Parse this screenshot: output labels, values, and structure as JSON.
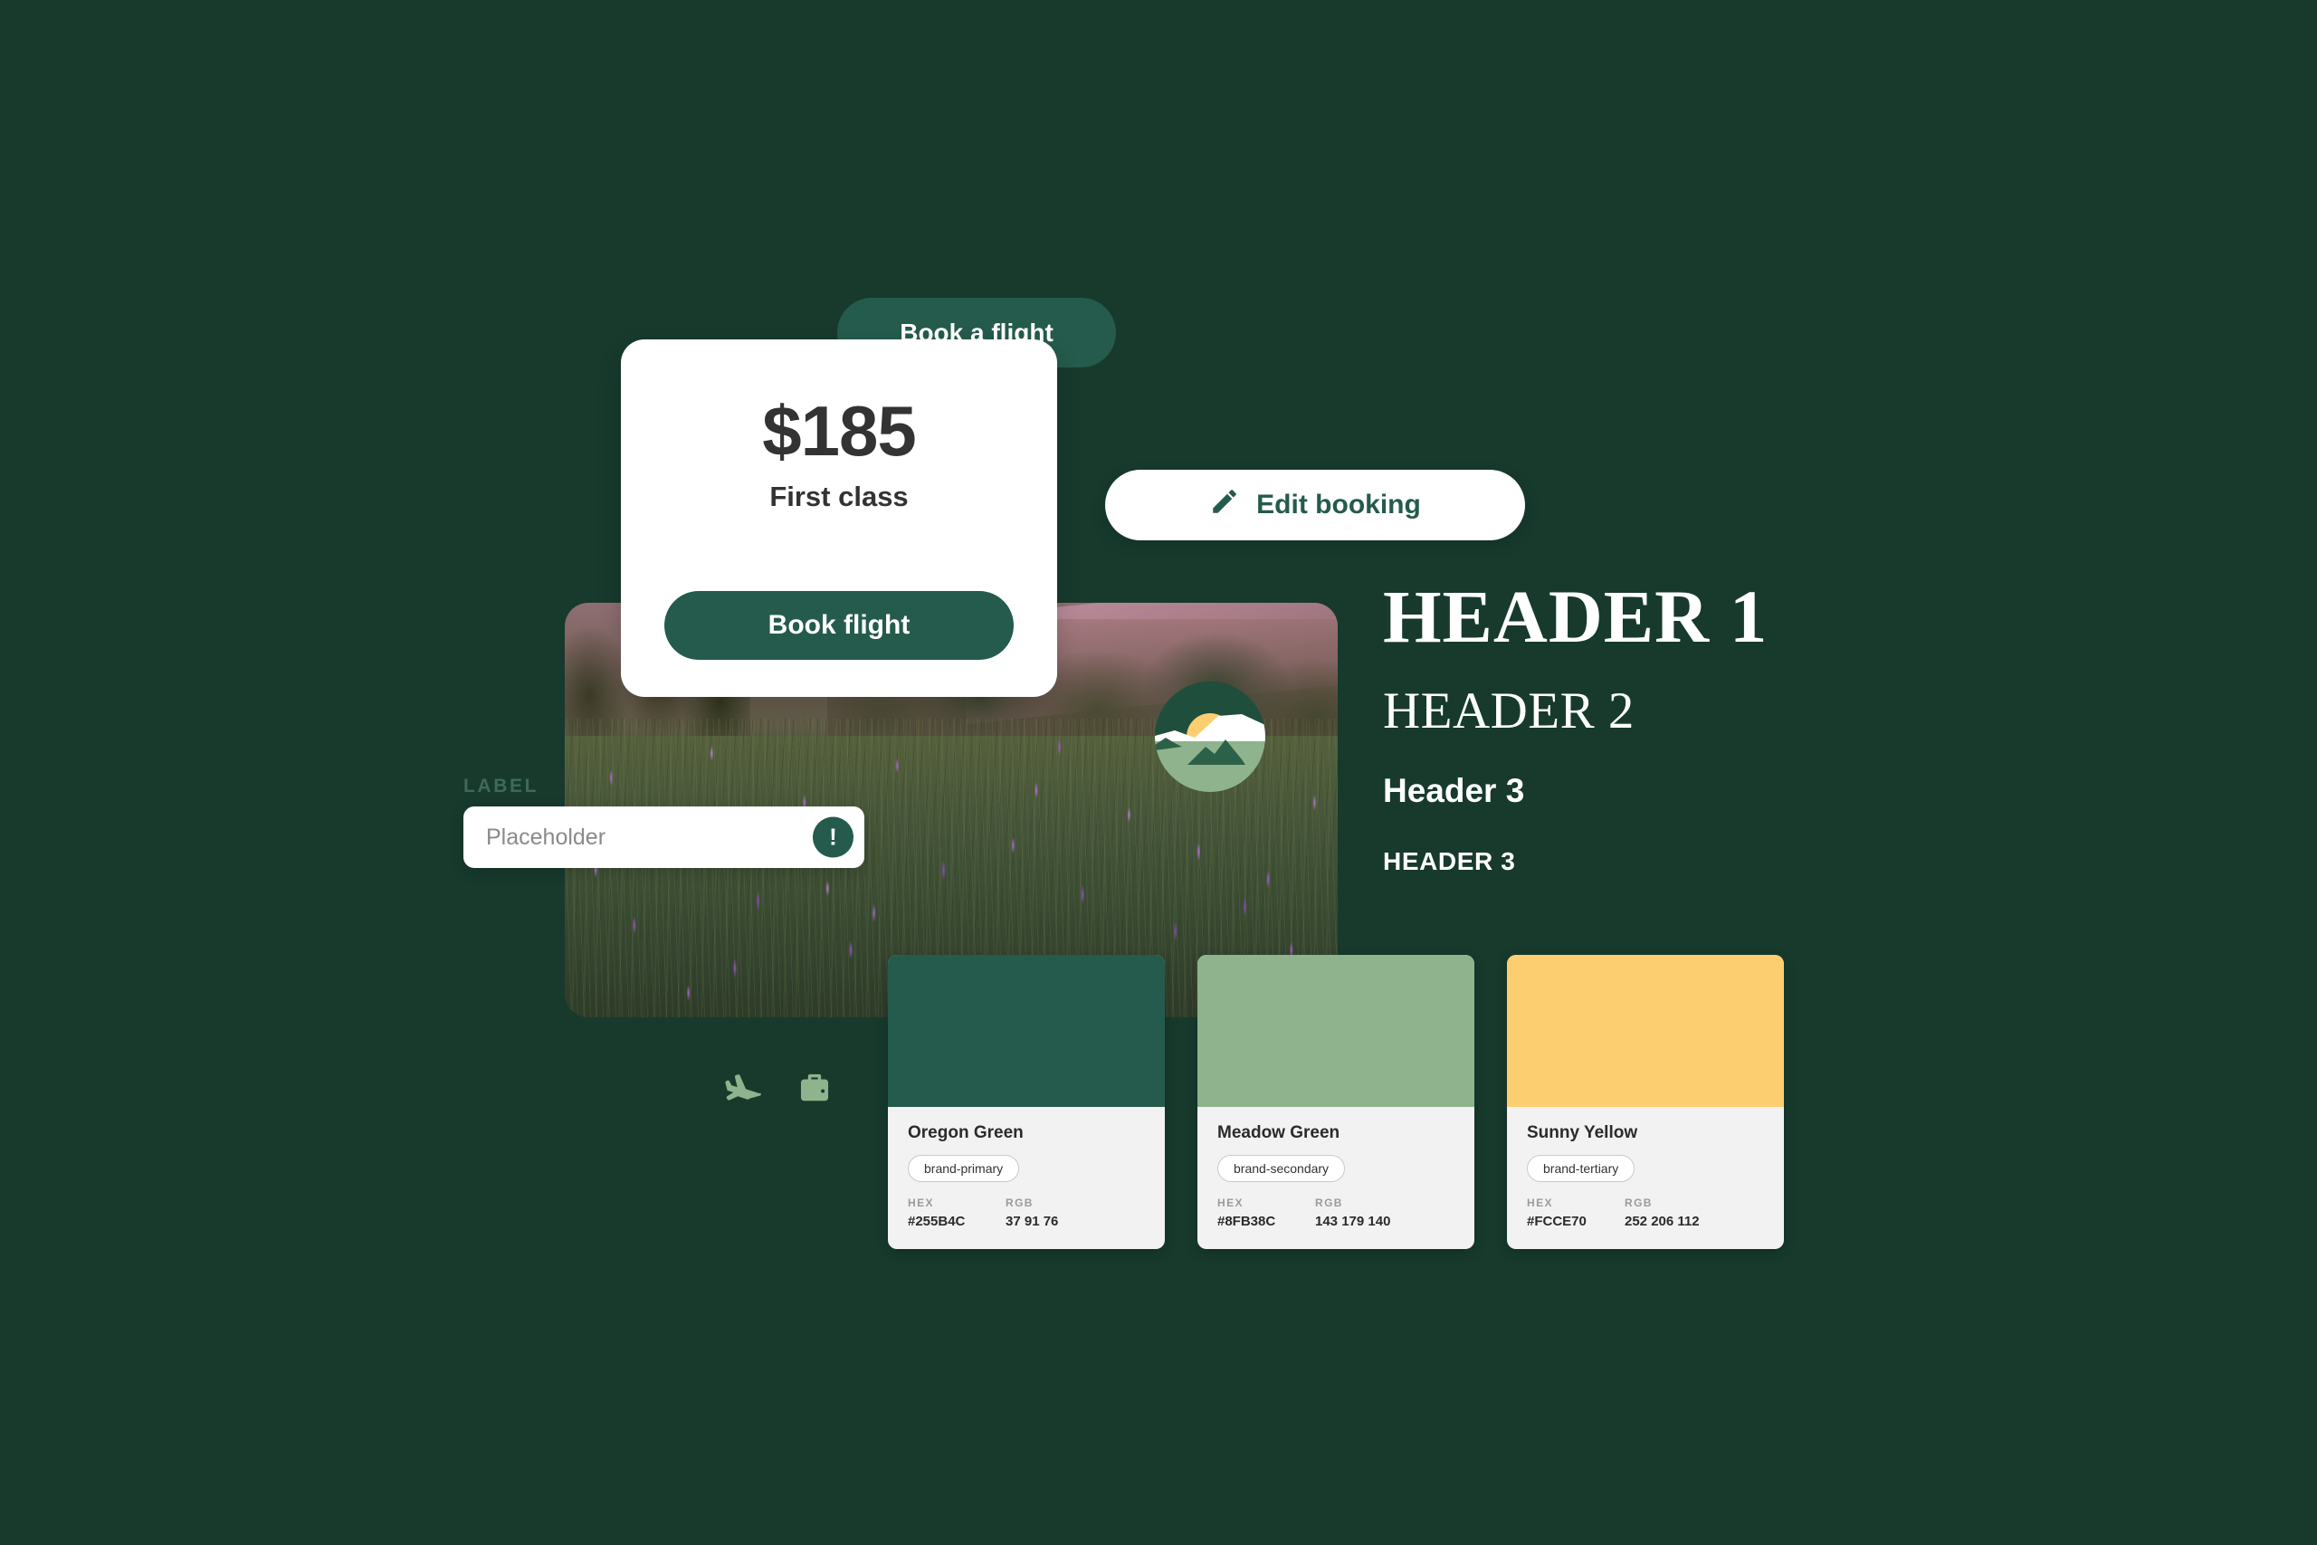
{
  "theme": {
    "background": "#173A2D",
    "brand_primary": "#255B4C",
    "brand_secondary": "#8FB38C",
    "brand_tertiary": "#FCCE70",
    "surface": "#FFFFFF",
    "swatch_panel": "#F2F2F2"
  },
  "pill_button": {
    "label": "Book a flight",
    "name": "book-a-flight-pill"
  },
  "price_card": {
    "amount": "$185",
    "tier": "First class",
    "cta_label": "Book flight"
  },
  "edit_booking": {
    "label": "Edit booking",
    "icon": "pencil-icon"
  },
  "input_field": {
    "label": "LABEL",
    "placeholder": "Placeholder",
    "value": "",
    "alert_glyph": "!",
    "alert_icon": "exclamation-icon"
  },
  "icons": [
    {
      "name": "airplane-icon",
      "label": "Airplane"
    },
    {
      "name": "suitcase-icon",
      "label": "Suitcase"
    }
  ],
  "logo": {
    "name": "landscape-sunrise-logo",
    "sky": "#1F4E3C",
    "sun": "#FCCE70",
    "cloud": "#FFFFFF",
    "ground": "#8FB38C",
    "mountain": "#2C6149"
  },
  "typography": {
    "header1": "HEADER 1",
    "header2": "HEADER 2",
    "header3": "Header 3",
    "header3_caps": "HEADER 3"
  },
  "swatch_labels": {
    "hex_key": "HEX",
    "rgb_key": "RGB"
  },
  "swatches": [
    {
      "name": "Oregon Green",
      "token": "brand-primary",
      "hex": "#255B4C",
      "rgb": "37 91 76"
    },
    {
      "name": "Meadow Green",
      "token": "brand-secondary",
      "hex": "#8FB38C",
      "rgb": "143 179 140"
    },
    {
      "name": "Sunny Yellow",
      "token": "brand-tertiary",
      "hex": "#FCCE70",
      "rgb": "252 206 112"
    }
  ]
}
